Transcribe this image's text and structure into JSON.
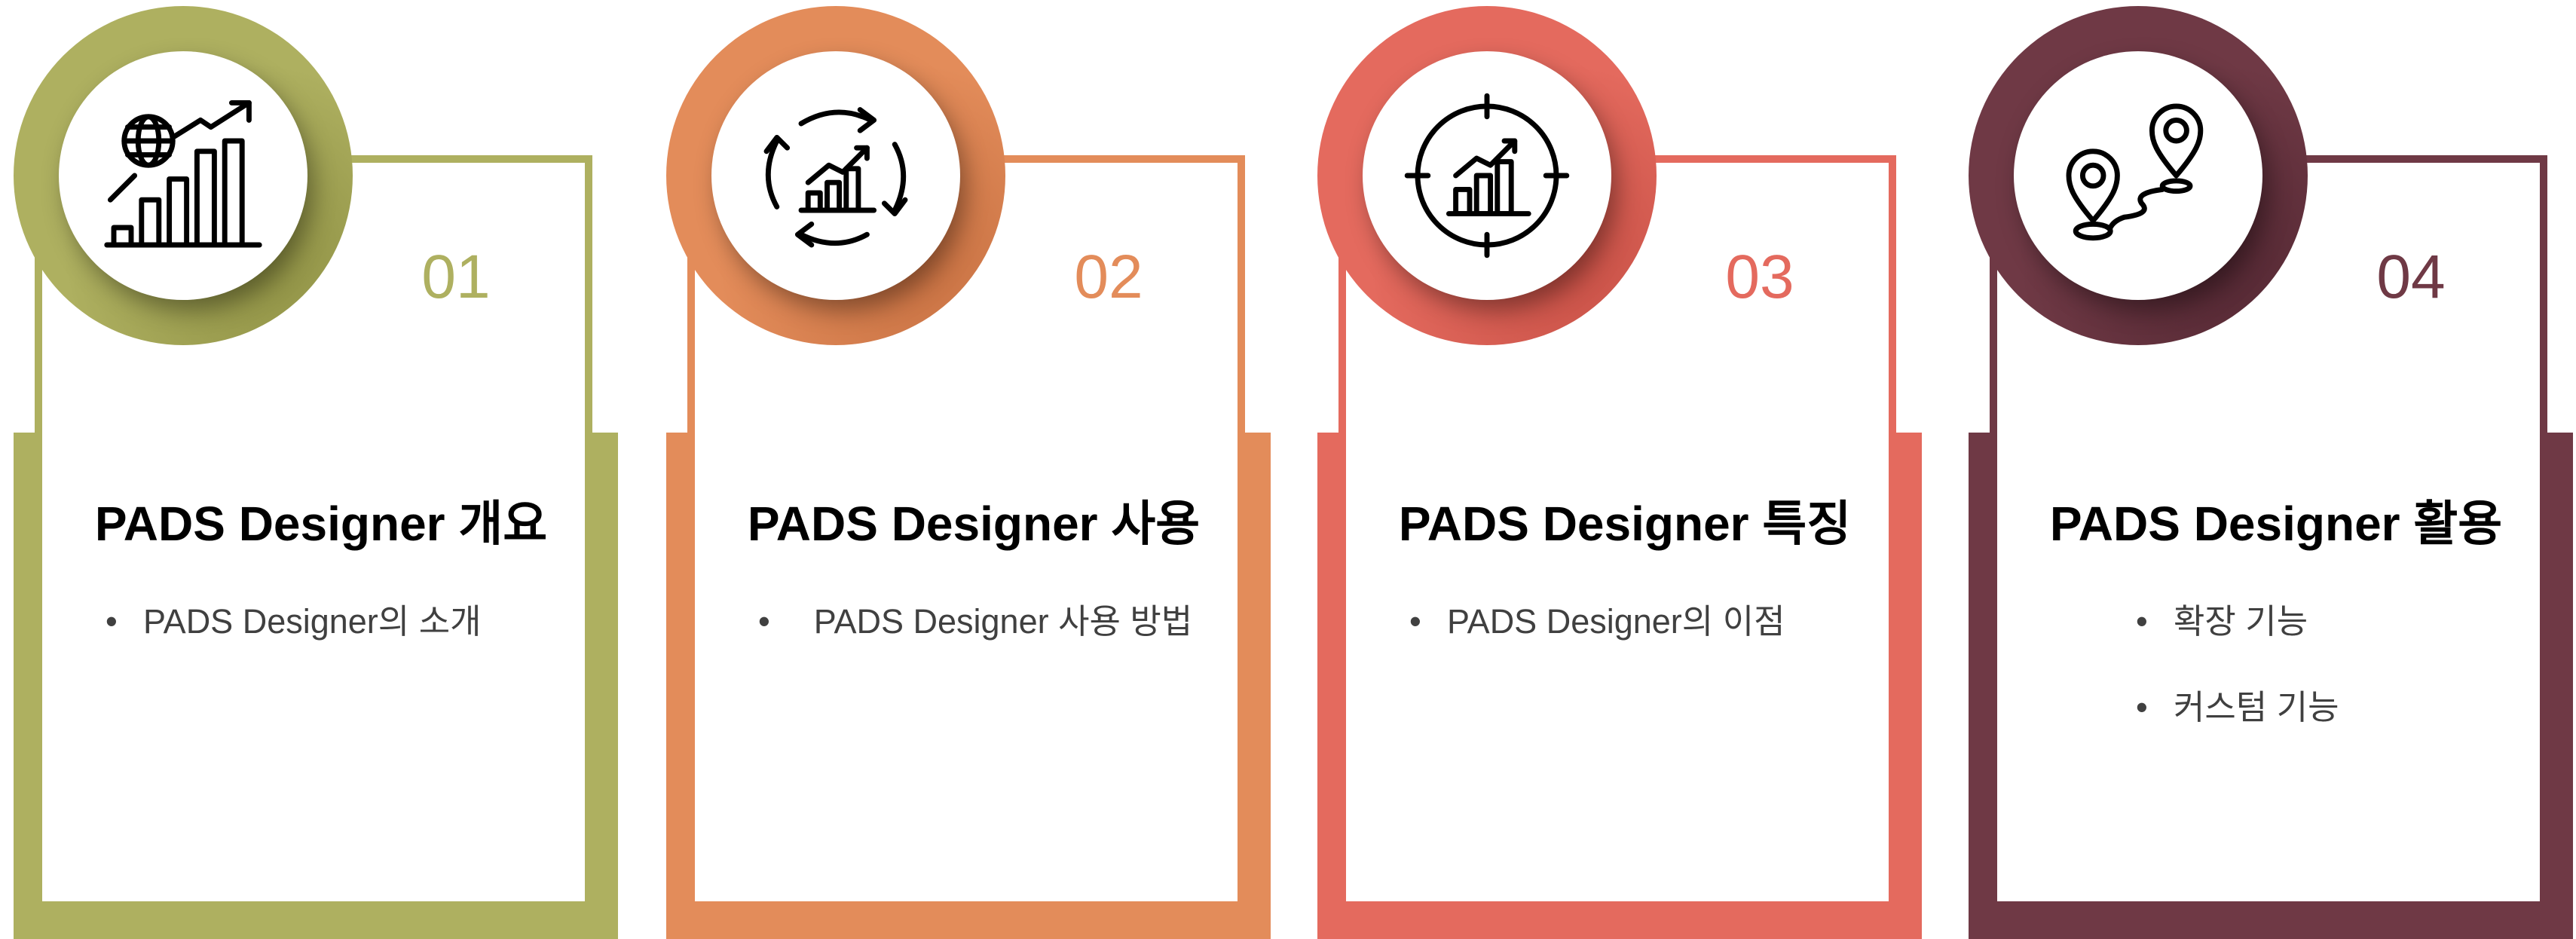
{
  "colors": {
    "card1": "#aeb060",
    "card2": "#e38c5a",
    "card3": "#e46a5e",
    "card4": "#6f3945"
  },
  "cards": [
    {
      "number": "01",
      "icon": "globe-growth-chart-icon",
      "title": "PADS Designer 개요",
      "bullets": [
        "PADS Designer의 소개"
      ]
    },
    {
      "number": "02",
      "icon": "cycle-growth-chart-icon",
      "title": "PADS Designer 사용",
      "bullets": [
        "PADS Designer 사용 방법"
      ]
    },
    {
      "number": "03",
      "icon": "target-chart-icon",
      "title": "PADS Designer 특징",
      "bullets": [
        "PADS Designer의 이점"
      ]
    },
    {
      "number": "04",
      "icon": "route-pins-icon",
      "title": "PADS Designer 활용",
      "bullets": [
        "확장 기능",
        "커스텀 기능"
      ]
    }
  ]
}
